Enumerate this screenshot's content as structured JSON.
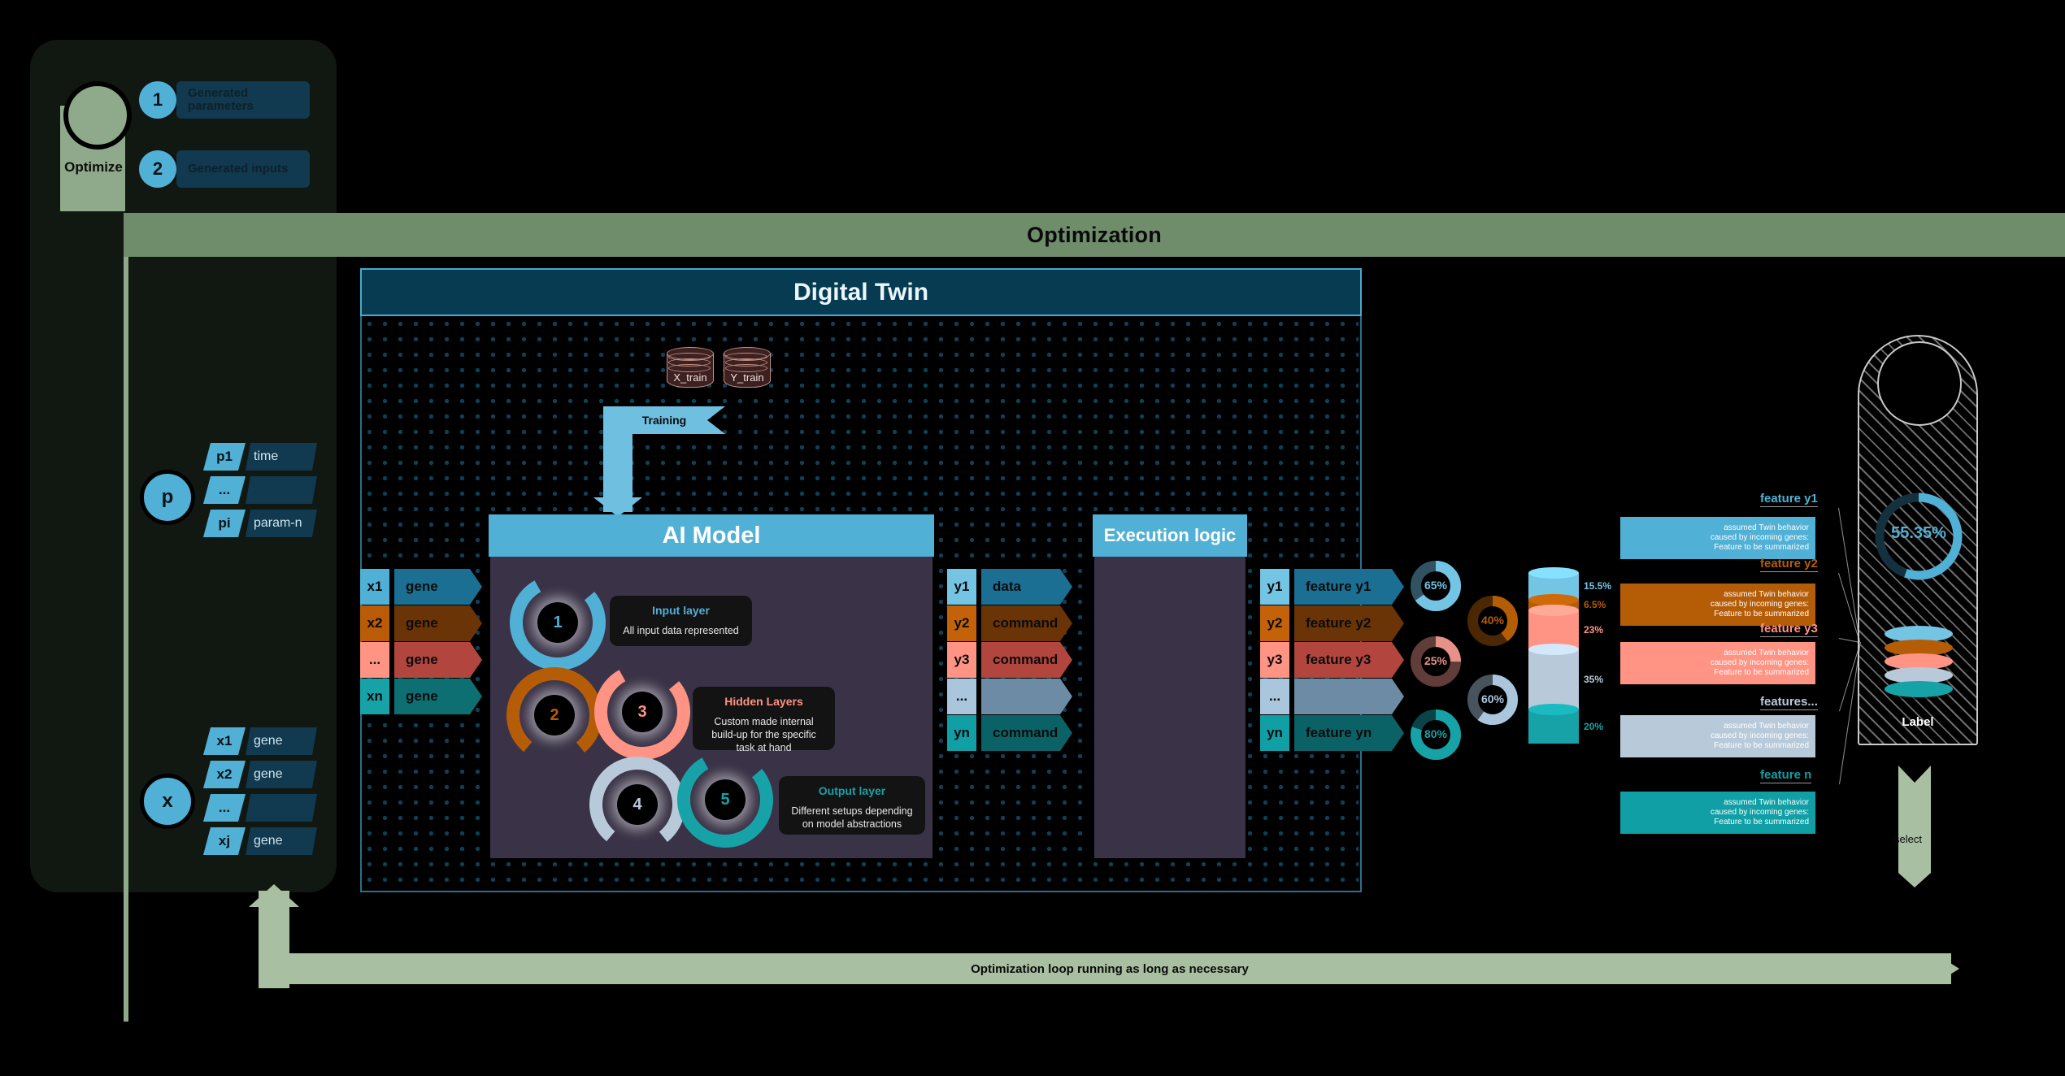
{
  "optimize_card": {
    "tag_label": "Optimize",
    "steps": [
      {
        "num": "1",
        "label": "Generated parameters"
      },
      {
        "num": "2",
        "label": "Generated inputs"
      }
    ]
  },
  "banner": {
    "title": "Optimization"
  },
  "parameters": {
    "group_label": "p",
    "rows": [
      {
        "key": "p1",
        "value": "time"
      },
      {
        "key": "...",
        "value": ""
      },
      {
        "key": "pi",
        "value": "param-n"
      }
    ]
  },
  "inputs": {
    "group_label": "x",
    "rows": [
      {
        "key": "x1",
        "value": "gene"
      },
      {
        "key": "x2",
        "value": "gene"
      },
      {
        "key": "...",
        "value": ""
      },
      {
        "key": "xj",
        "value": "gene"
      }
    ]
  },
  "digital_twin": {
    "title": "Digital Twin",
    "databases": [
      {
        "name": "X_train"
      },
      {
        "name": "Y_train"
      }
    ],
    "training_arrow": "Training",
    "ai_model": {
      "title": "AI Model",
      "nodes": [
        "1",
        "2",
        "3",
        "4",
        "5"
      ],
      "cards": [
        {
          "title": "Input layer",
          "desc": "All input data represented",
          "color": "#51b0d5"
        },
        {
          "title": "Hidden Layers",
          "desc": "Custom made internal build-up for the specific task at hand",
          "color": "#ff9384"
        },
        {
          "title": "Output layer",
          "desc": "Different setups depending on model abstractions",
          "color": "#17a2a8"
        }
      ]
    },
    "execution_logic": {
      "title": "Execution logic"
    },
    "gene_inputs": [
      {
        "key": "x1",
        "value": "gene",
        "key_color": "#51b0d5",
        "bar_color": "#1a6f92"
      },
      {
        "key": "x2",
        "value": "gene",
        "key_color": "#ba5b08",
        "bar_color": "#6b3406"
      },
      {
        "key": "...",
        "value": "gene",
        "key_color": "#ff9384",
        "bar_color": "#b2463f"
      },
      {
        "key": "xn",
        "value": "gene",
        "key_color": "#17a2a8",
        "bar_color": "#0e6f73"
      }
    ],
    "outputs": [
      {
        "key": "y1",
        "value": "data",
        "key_color": "#74c4e4",
        "bar_color": "#1a6f92"
      },
      {
        "key": "y2",
        "value": "command",
        "key_color": "#c4620a",
        "bar_color": "#6b3406"
      },
      {
        "key": "y3",
        "value": "command",
        "key_color": "#ff9384",
        "bar_color": "#b2463f"
      },
      {
        "key": "...",
        "value": "",
        "key_color": "#aac6dd",
        "bar_color": "#6d8ba5"
      },
      {
        "key": "yn",
        "value": "command",
        "key_color": "#0f9fa5",
        "bar_color": "#0b6266"
      }
    ]
  },
  "features": {
    "rows": [
      {
        "key": "y1",
        "value": "feature y1",
        "key_color": "#74c4e4",
        "bar_color": "#1a6f92"
      },
      {
        "key": "y2",
        "value": "feature y2",
        "key_color": "#c4620a",
        "bar_color": "#6b3406"
      },
      {
        "key": "y3",
        "value": "feature y3",
        "key_color": "#ff9384",
        "bar_color": "#b2463f"
      },
      {
        "key": "...",
        "value": "",
        "key_color": "#aac6dd",
        "bar_color": "#6d8ba5"
      },
      {
        "key": "yn",
        "value": "feature yn",
        "key_color": "#0f9fa5",
        "bar_color": "#0b6266"
      }
    ]
  },
  "donuts": [
    {
      "label": "65%",
      "value": 65,
      "color": "#74c4e4"
    },
    {
      "label": "40%",
      "value": 40,
      "color": "#b55c07"
    },
    {
      "label": "25%",
      "value": 25,
      "color": "#e79288"
    },
    {
      "label": "60%",
      "value": 60,
      "color": "#aac6dd"
    },
    {
      "label": "80%",
      "value": 80,
      "color": "#17a2a8"
    }
  ],
  "stack": {
    "segments": [
      {
        "label": "15.5%",
        "value": 15.5,
        "color": "#74c4e4"
      },
      {
        "label": "6.5%",
        "value": 6.5,
        "color": "#b55c07"
      },
      {
        "label": "23%",
        "value": 23,
        "color": "#ff9384"
      },
      {
        "label": "35%",
        "value": 35,
        "color": "#b8cada"
      },
      {
        "label": "20%",
        "value": 20,
        "color": "#17a2a8"
      }
    ]
  },
  "callouts": [
    {
      "title": "feature y1",
      "body": "assumed Twin behavior caused by incoming genes: Feature to be summarized",
      "color": "#51b0d5",
      "title_color": "#51b0d5"
    },
    {
      "title": "feature y2",
      "body": "assumed Twin behavior caused by incoming genes: Feature to be summarized",
      "color": "#b55c07",
      "title_color": "#b55c07"
    },
    {
      "title": "feature y3",
      "body": "assumed Twin behavior caused by incoming genes: Feature to be summarized",
      "color": "#ff9384",
      "title_color": "#ff9384"
    },
    {
      "title": "features...",
      "body": "assumed Twin behavior caused by incoming genes: Feature to be summarized",
      "color": "#b8cada",
      "title_color": "#b8cada"
    },
    {
      "title": "feature n",
      "body": "assumed Twin behavior caused by incoming genes: Feature to be summarized",
      "color": "#0f9fa5",
      "title_color": "#0f9fa5"
    }
  ],
  "label_tag": {
    "score": "55.35%",
    "score_value": 55.35,
    "caption": "Label",
    "discs": [
      "#74c4e4",
      "#b55c07",
      "#ff9384",
      "#b8cada",
      "#17a2a8"
    ]
  },
  "select_arrow": {
    "text": "select"
  },
  "loop": {
    "text": "Optimization loop running as long as necessary"
  }
}
